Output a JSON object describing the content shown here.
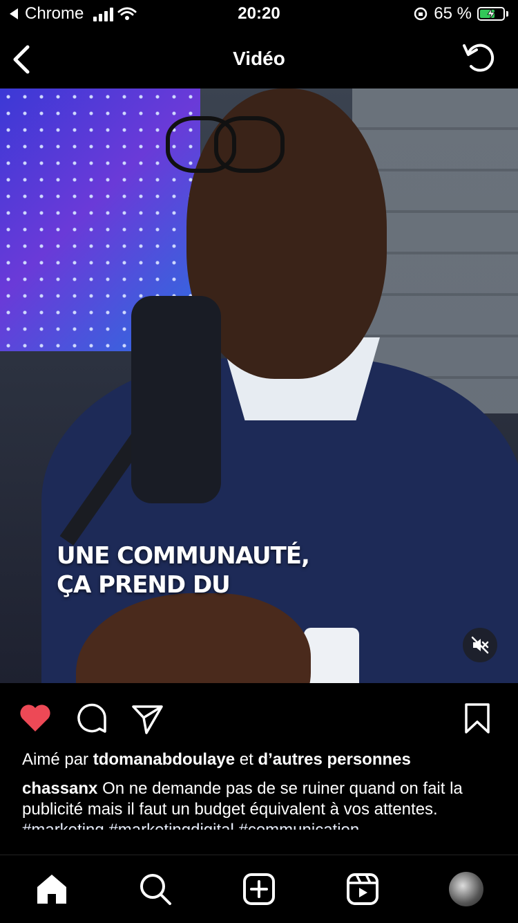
{
  "status": {
    "back_app": "Chrome",
    "time": "20:20",
    "battery_percent": "65 %",
    "battery_level": 0.65,
    "charging": true
  },
  "nav": {
    "title": "Vidéo"
  },
  "video": {
    "caption_line1": "UNE COMMUNAUTÉ,",
    "caption_line2": "ÇA PREND DU",
    "muted": true
  },
  "post": {
    "liked": true,
    "likes_prefix": "Aimé par",
    "liked_by_user": "tdomanabdoulaye",
    "likes_and": "et",
    "likes_others": "d’autres personnes",
    "author": "chassanx",
    "text": "On ne demande pas de se ruiner quand on fait la publicité mais il faut un budget équivalent à vos attentes.",
    "hashtags": "#marketing #marketingdigital #communication"
  },
  "colors": {
    "like_red": "#ed4956",
    "background": "#000000",
    "battery_green": "#33c759"
  },
  "icons": {
    "home": "home-icon",
    "search": "search-icon",
    "new_post": "plus-square-icon",
    "reels": "reels-icon",
    "profile": "avatar"
  }
}
